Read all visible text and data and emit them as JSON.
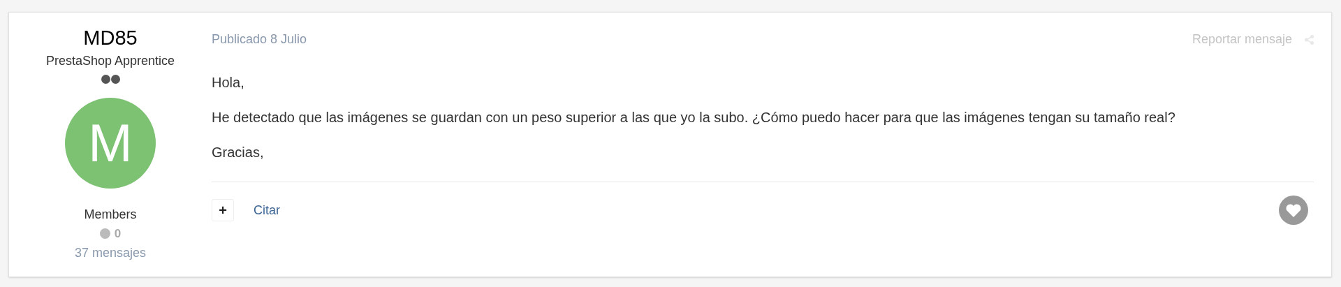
{
  "author": {
    "name": "MD85",
    "rank": "PrestaShop Apprentice",
    "rank_pips": [
      {
        "filled": true
      },
      {
        "filled": true
      }
    ],
    "avatar_letter": "M",
    "group": "Members",
    "reputation": "0",
    "posts": "37 mensajes"
  },
  "post": {
    "published": "Publicado 8 Julio",
    "report": "Reportar mensaje",
    "paragraphs": [
      "Hola,",
      "He detectado que las imágenes se guardan con un peso superior a las que yo la subo. ¿Cómo puedo hacer para que las imágenes tengan su tamaño real?",
      "Gracias,"
    ]
  },
  "actions": {
    "multiquote": "+",
    "quote": "Citar"
  }
}
